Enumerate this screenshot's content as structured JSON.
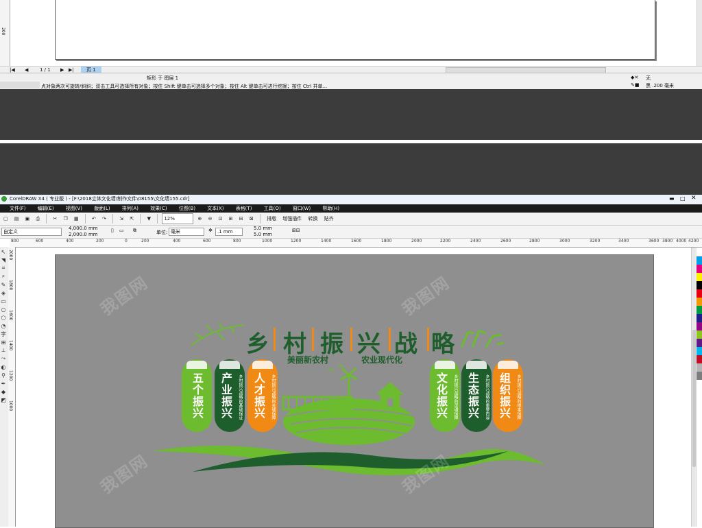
{
  "top_app": {
    "page_nav_count": "1 / 1",
    "page_tab": "页 1",
    "status_object": "矩形 于 图层 1",
    "status_hint": "点对象两次可旋转/斜斜；双击工具可选择所有对象；按住 Shift 键单击可选择多个对象；按住 Alt 键单击可进行挖掘；按住 Ctrl 并单...",
    "fill_label": "无",
    "outline_label": "黑 .200 毫米",
    "ruler_mark": "200"
  },
  "app": {
    "title": "CorelDRAW X4 ( 专业版 ) - [F:\\2018立体文化墙\\制作文件\\08155\\文化墙155.cdr]",
    "menu": [
      "文件(F)",
      "编辑(E)",
      "视图(V)",
      "版面(L)",
      "排列(A)",
      "效果(C)",
      "位图(B)",
      "文本(X)",
      "表格(T)",
      "工具(O)",
      "窗口(W)",
      "帮助(H)"
    ],
    "toolbar": {
      "zoom": "12%",
      "snap_label": "贴齐",
      "rearrange_label": "排版",
      "extensions_label": "增强插件",
      "convert_label": "转换",
      "paste_label": "贴齐"
    },
    "propbar": {
      "preset": "自定义",
      "width": "4,000.0 mm",
      "height": "2,000.0 mm",
      "unit_label": "单位:",
      "unit": "毫米",
      "nudge": ".1 mm",
      "dup_x": "5.0 mm",
      "dup_y": "5.0 mm"
    },
    "ruler": [
      "800",
      "600",
      "400",
      "200",
      "0",
      "200",
      "400",
      "600",
      "800",
      "1000",
      "1200",
      "1400",
      "1600",
      "1800",
      "2000",
      "2200",
      "2400",
      "2600",
      "2800",
      "3000",
      "3200",
      "3400",
      "3600",
      "3800",
      "4000",
      "4200"
    ],
    "vruler": [
      "2000",
      "1800",
      "1600",
      "1400",
      "1200",
      "1000"
    ]
  },
  "design": {
    "title": "乡村振兴战略",
    "subtitle_left": "美丽新农村",
    "subtitle_right": "农业现代化",
    "pills": [
      {
        "text": "五个振兴",
        "sub": "",
        "color": "#6dbb2e"
      },
      {
        "text": "产业振兴",
        "sub": "乡村振兴战略的基础保证",
        "color": "#1e5e2c"
      },
      {
        "text": "人才振兴",
        "sub": "乡村振兴战略的关键保障",
        "color": "#f08a14"
      },
      {
        "text": "文化振兴",
        "sub": "乡村振兴战略的灵魂保障",
        "color": "#6dbb2e"
      },
      {
        "text": "生态振兴",
        "sub": "乡村振兴战略的重要内容",
        "color": "#1e5e2c"
      },
      {
        "text": "组织振兴",
        "sub": "乡村振兴战略的根本保障",
        "color": "#f08a14"
      }
    ],
    "colors": {
      "green": "#6dbb2e",
      "dark_green": "#1e5e2c",
      "orange": "#f08a14",
      "board": "#8f8f8f"
    }
  }
}
